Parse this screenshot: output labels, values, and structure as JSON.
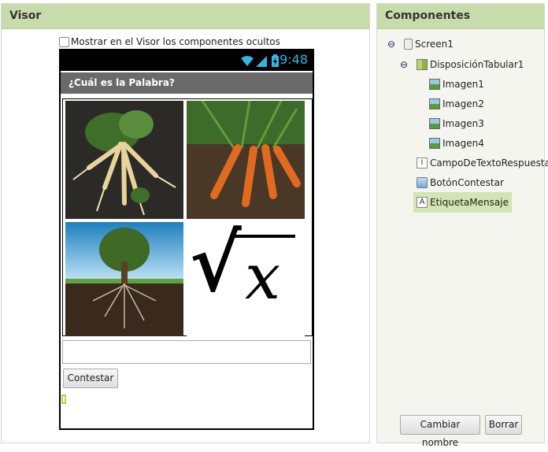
{
  "visor": {
    "header": "Visor",
    "show_hidden_label": "Mostrar en el Visor los componentes ocultos",
    "phone": {
      "time": "9:48",
      "title": "¿Cuál es la Palabra?",
      "button_label": "Contestar",
      "input_value": ""
    },
    "images": [
      {
        "name": "roots-photo"
      },
      {
        "name": "carrots-photo"
      },
      {
        "name": "tree-roots-photo"
      },
      {
        "name": "square-root-x"
      }
    ],
    "sqrt_symbol": "√",
    "sqrt_var": "x"
  },
  "componentes": {
    "header": "Componentes",
    "tree": [
      {
        "label": "Screen1",
        "icon": "screen-icon",
        "depth": 0,
        "toggle": "⊖"
      },
      {
        "label": "DisposiciónTabular1",
        "icon": "table-layout-icon",
        "depth": 1,
        "toggle": "⊖"
      },
      {
        "label": "Imagen1",
        "icon": "image-icon",
        "depth": 2
      },
      {
        "label": "Imagen2",
        "icon": "image-icon",
        "depth": 2
      },
      {
        "label": "Imagen3",
        "icon": "image-icon",
        "depth": 2
      },
      {
        "label": "Imagen4",
        "icon": "image-icon",
        "depth": 2
      },
      {
        "label": "CampoDeTextoRespuesta",
        "icon": "textbox-icon",
        "depth": 1
      },
      {
        "label": "BotónContestar",
        "icon": "button-icon",
        "depth": 1
      },
      {
        "label": "EtiquetaMensaje",
        "icon": "label-icon",
        "depth": 1,
        "selected": true
      }
    ],
    "rename_label": "Cambiar nombre",
    "delete_label": "Borrar"
  }
}
